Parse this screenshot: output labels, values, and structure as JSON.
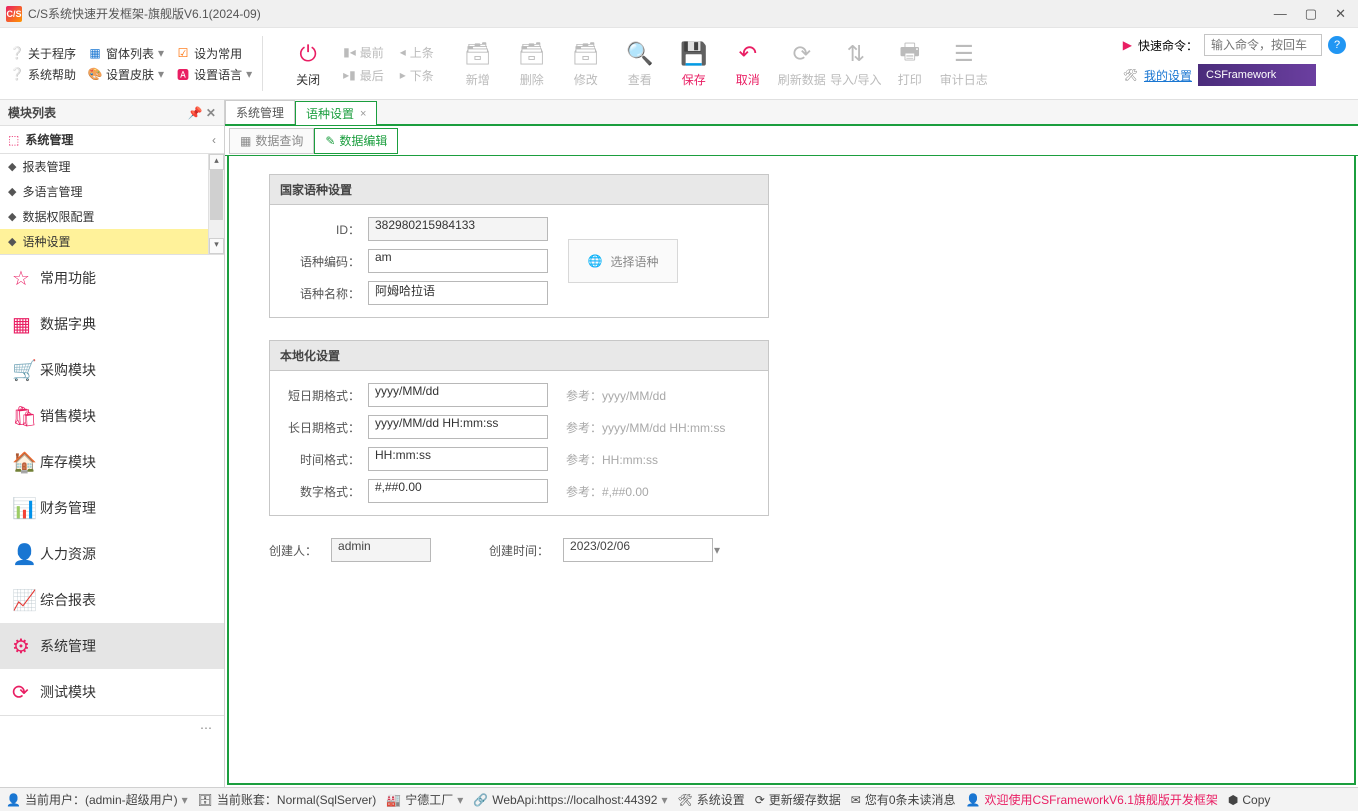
{
  "title": "C/S系统快速开发框架-旗舰版V6.1(2024-09)",
  "menu_left": {
    "about": "关于程序",
    "window_list": "窗体列表",
    "set_common": "设为常用",
    "sys_help": "系统帮助",
    "set_skin": "设置皮肤",
    "set_lang": "设置语言"
  },
  "toolbar": {
    "close": "关闭",
    "first": "最前",
    "last": "最后",
    "prev": "上条",
    "next": "下条",
    "add": "新增",
    "delete": "删除",
    "modify": "修改",
    "view": "查看",
    "save": "保存",
    "cancel": "取消",
    "refresh": "刷新数据",
    "import_export": "导入/导入",
    "print": "打印",
    "audit_log": "审计日志"
  },
  "quick": {
    "label": "快速命令：",
    "placeholder": "输入命令，按回车",
    "settings": "我的设置",
    "promo": "CSFramework"
  },
  "module_list": {
    "header": "模块列表",
    "section": "系统管理",
    "items": [
      "报表管理",
      "多语言管理",
      "数据权限配置",
      "语种设置"
    ],
    "selected_index": 3,
    "nav": [
      "常用功能",
      "数据字典",
      "采购模块",
      "销售模块",
      "库存模块",
      "财务管理",
      "人力资源",
      "综合报表",
      "系统管理",
      "测试模块"
    ],
    "nav_active_index": 8
  },
  "doc_tabs": [
    "系统管理",
    "语种设置"
  ],
  "doc_active_index": 1,
  "sub_tabs": [
    "数据查询",
    "数据编辑"
  ],
  "sub_active_index": 1,
  "panel1": {
    "title": "国家语种设置",
    "id_label": "ID：",
    "id_value": "382980215984133",
    "code_label": "语种编码：",
    "code_value": "am",
    "name_label": "语种名称：",
    "name_value": "阿姆哈拉语",
    "choose_lang": "选择语种"
  },
  "panel2": {
    "title": "本地化设置",
    "short_date_label": "短日期格式：",
    "short_date_value": "yyyy/MM/dd",
    "short_date_hint": "参考：yyyy/MM/dd",
    "long_date_label": "长日期格式：",
    "long_date_value": "yyyy/MM/dd HH:mm:ss",
    "long_date_hint": "参考：yyyy/MM/dd HH:mm:ss",
    "time_label": "时间格式：",
    "time_value": "HH:mm:ss",
    "time_hint": "参考：HH:mm:ss",
    "number_label": "数字格式：",
    "number_value": "#,##0.00",
    "number_hint": "参考：#,##0.00"
  },
  "meta": {
    "creator_label": "创建人：",
    "creator_value": "admin",
    "create_time_label": "创建时间：",
    "create_time_value": "2023/02/06"
  },
  "statusbar": {
    "user": "当前用户：(admin-超级用户)",
    "account": "当前账套：Normal(SqlServer)",
    "factory": "宁德工厂",
    "webapi": "WebApi:https://localhost:44392",
    "sys_settings": "系统设置",
    "update_cache": "更新缓存数据",
    "unread": "您有0条未读消息",
    "welcome": "欢迎使用CSFrameworkV6.1旗舰版开发框架",
    "copy": "Copy"
  }
}
